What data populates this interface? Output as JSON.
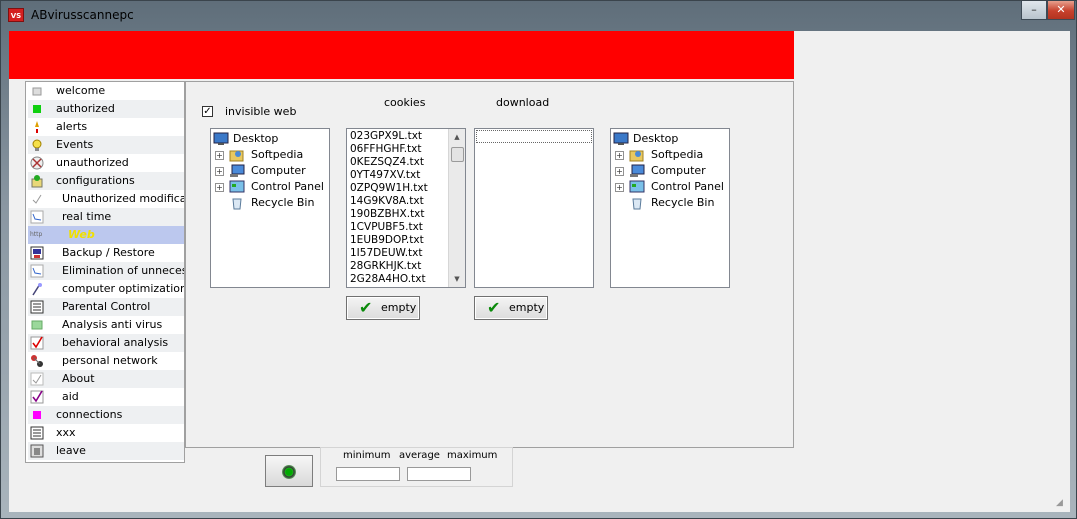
{
  "window": {
    "title": "ABvirusscannepc",
    "app_icon_text": "VS",
    "controls": {
      "minimize": "–",
      "maximize": "□",
      "close": "✕"
    }
  },
  "sidebar": {
    "items": [
      {
        "label": "welcome",
        "icon": "page-icon"
      },
      {
        "label": "authorized",
        "icon": "green-square-icon"
      },
      {
        "label": "alerts",
        "icon": "alert-icon"
      },
      {
        "label": "Events",
        "icon": "lightbulb-icon"
      },
      {
        "label": "unauthorized",
        "icon": "no-entry-icon"
      },
      {
        "label": "configurations",
        "icon": "config-icon"
      },
      {
        "label": "Unauthorized modification",
        "icon": "check-small-icon"
      },
      {
        "label": "real time",
        "icon": "graph-icon"
      },
      {
        "label": "Web",
        "icon": "http-icon"
      },
      {
        "label": "Backup / Restore",
        "icon": "backup-icon"
      },
      {
        "label": "Elimination of unnecessary",
        "icon": "graph-icon"
      },
      {
        "label": "computer optimization",
        "icon": "wand-icon"
      },
      {
        "label": "Parental Control",
        "icon": "list-icon"
      },
      {
        "label": "Analysis anti virus",
        "icon": "green-rect-icon"
      },
      {
        "label": "behavioral analysis",
        "icon": "red-check-icon"
      },
      {
        "label": "personal network",
        "icon": "network-icon"
      },
      {
        "label": "About",
        "icon": "check-small-icon"
      },
      {
        "label": "aid",
        "icon": "purple-check-icon"
      },
      {
        "label": "connections",
        "icon": "magenta-square-icon"
      },
      {
        "label": "xxx",
        "icon": "list-icon"
      },
      {
        "label": "leave",
        "icon": "exit-icon"
      }
    ]
  },
  "web_panel": {
    "invisible_web_label": "invisible web",
    "invisible_web_checked": "✓",
    "cookies_label": "cookies",
    "download_label": "download",
    "tree_items": [
      "Desktop",
      "Softpedia",
      "Computer",
      "Control Panel",
      "Recycle Bin"
    ],
    "cookie_files": [
      "023GPX9L.txt",
      "06FFHGHF.txt",
      "0KEZSQZ4.txt",
      "0YT497XV.txt",
      "0ZPQ9W1H.txt",
      "14G9KV8A.txt",
      "190BZBHX.txt",
      "1CVPUBF5.txt",
      "1EUB9DOP.txt",
      "1I57DEUW.txt",
      "28GRKHJK.txt",
      "2G28A4HO.txt"
    ],
    "empty_button_label": "empty"
  },
  "bottom": {
    "minimum_label": "minimum",
    "average_label": "average",
    "maximum_label": "maximum"
  },
  "colors": {
    "banner": "#ff0000",
    "selected_item": "#bcc8ee",
    "selected_text": "#f0e000"
  }
}
